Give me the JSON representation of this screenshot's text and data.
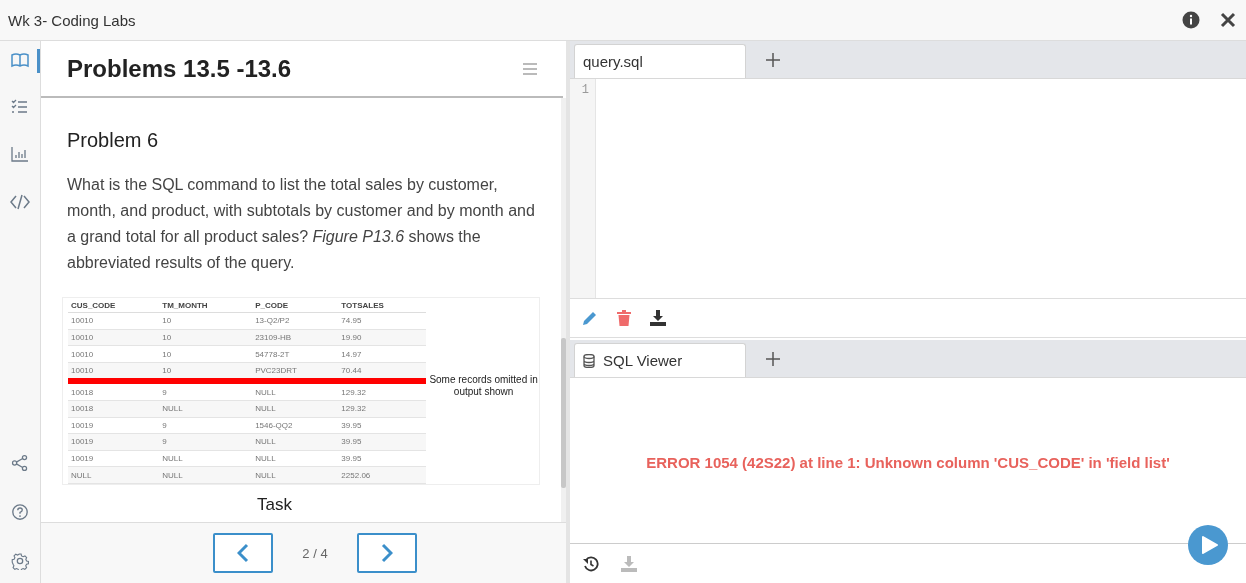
{
  "window": {
    "title": "Wk 3- Coding Labs"
  },
  "rail": {
    "items": [
      {
        "kind": "book",
        "selected": true
      },
      {
        "kind": "checklist",
        "selected": false
      },
      {
        "kind": "chart",
        "selected": false
      },
      {
        "kind": "code",
        "selected": false
      }
    ],
    "bottom": [
      {
        "kind": "share"
      },
      {
        "kind": "help"
      },
      {
        "kind": "settings"
      }
    ]
  },
  "lesson": {
    "title": "Problems 13.5 -13.6",
    "heading": "Problem 6",
    "text": "What is the SQL command to list the total sales by customer, month, and product, with subtotals by customer and by month and a grand total for all product sales? *Figure P13.6* shows the abbreviated results of the query.",
    "figure": {
      "columns": [
        "CUS_CODE",
        "TM_MONTH",
        "P_CODE",
        "TOTSALES"
      ],
      "rows": [
        {
          "cells": [
            "10010",
            "10",
            "13-Q2/P2",
            "74.95"
          ],
          "cut_after": false
        },
        {
          "cells": [
            "10010",
            "10",
            "23109-HB",
            "19.90"
          ],
          "cut_after": false
        },
        {
          "cells": [
            "10010",
            "10",
            "54778-2T",
            "14.97"
          ],
          "cut_after": false
        },
        {
          "cells": [
            "10010",
            "10",
            "PVC23DRT",
            "70.44"
          ],
          "cut_after": true
        },
        {
          "cells": [
            "10018",
            "9",
            "NULL",
            "129.32"
          ],
          "cut_after": false
        },
        {
          "cells": [
            "10018",
            "NULL",
            "NULL",
            "129.32"
          ],
          "cut_after": false
        },
        {
          "cells": [
            "10019",
            "9",
            "1546-QQ2",
            "39.95"
          ],
          "cut_after": false
        },
        {
          "cells": [
            "10019",
            "9",
            "NULL",
            "39.95"
          ],
          "cut_after": false
        },
        {
          "cells": [
            "10019",
            "NULL",
            "NULL",
            "39.95"
          ],
          "cut_after": false
        },
        {
          "cells": [
            "NULL",
            "NULL",
            "NULL",
            "2252.06"
          ],
          "cut_after": false
        }
      ],
      "note": "Some records omitted in output shown"
    },
    "next_heading": "Task",
    "pager": "2 / 4"
  },
  "editor": {
    "tabs": [
      {
        "label": "query.sql",
        "selected": true
      }
    ],
    "line_numbers": [
      "1"
    ]
  },
  "viewer": {
    "tabs": [
      {
        "label": "SQL Viewer",
        "selected": true
      }
    ],
    "error": "ERROR 1054 (42S22) at line 1: Unknown column 'CUS_CODE' in 'field list'"
  }
}
